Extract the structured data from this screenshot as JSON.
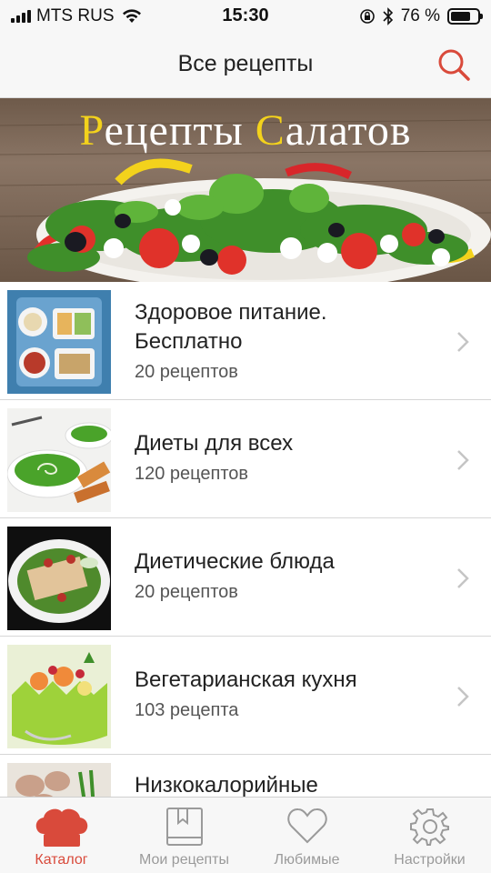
{
  "status_bar": {
    "carrier": "MTS RUS",
    "time": "15:30",
    "battery": "76 %",
    "battery_level": 0.76
  },
  "nav": {
    "title": "Все рецепты"
  },
  "banner": {
    "title_first_letter_1": "Р",
    "title_word_1_rest": "ецепты ",
    "title_first_letter_2": "С",
    "title_word_2_rest": "алатов"
  },
  "recipes": [
    {
      "title": "Здоровое питание. Бесплатно",
      "count": "20 рецептов",
      "thumb": "hospital-tray"
    },
    {
      "title": "Диеты для всех",
      "count": "120 рецептов",
      "thumb": "green-soup"
    },
    {
      "title": "Диетические блюда",
      "count": "20 рецептов",
      "thumb": "chicken-salad"
    },
    {
      "title": "Вегетарианская кухня",
      "count": "103 рецепта",
      "thumb": "melon-basket"
    },
    {
      "title": "Низкокалорийные",
      "count": "",
      "thumb": "meat-plate"
    }
  ],
  "tabs": [
    {
      "label": "Каталог",
      "icon": "chef-hat-icon",
      "active": true
    },
    {
      "label": "Мои рецепты",
      "icon": "book-icon",
      "active": false
    },
    {
      "label": "Любимые",
      "icon": "heart-icon",
      "active": false
    },
    {
      "label": "Настройки",
      "icon": "gear-icon",
      "active": false
    }
  ],
  "colors": {
    "accent": "#d94a3b",
    "banner_letter": "#f3d21c",
    "inactive_tab": "#9a9a9a"
  }
}
